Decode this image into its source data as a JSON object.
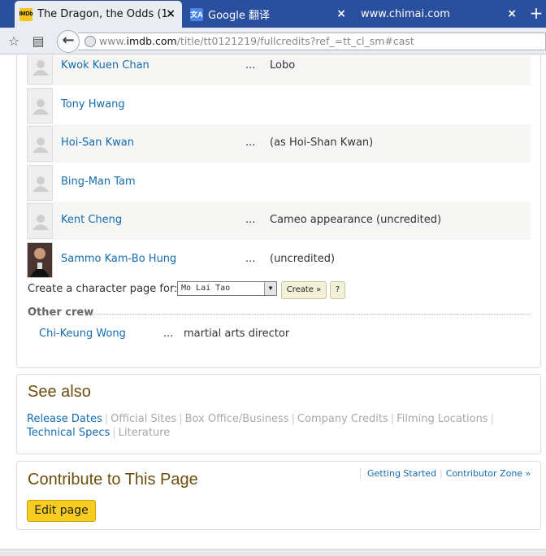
{
  "browser": {
    "tabs": [
      {
        "title": "The Dragon, the Odds (1...",
        "icon": "imdb-favicon",
        "active": true
      },
      {
        "title": "Google 翻译",
        "icon": "google-translate-favicon",
        "active": false
      },
      {
        "title": "www.chimai.com",
        "icon": "",
        "active": false
      }
    ],
    "url_prefix": "www.",
    "url_host": "imdb.com",
    "url_path": "/title/tt0121219/fullcredits?ref_=tt_cl_sm#cast",
    "new_tab": "+",
    "close": "×",
    "back": "←"
  },
  "cast": [
    {
      "name": "Kwok Kuen Chan",
      "ellipsis": "...",
      "character": "Lobo",
      "photo": "placeholder"
    },
    {
      "name": "Tony Hwang",
      "ellipsis": "",
      "character": "",
      "photo": "placeholder"
    },
    {
      "name": "Hoi-San Kwan",
      "ellipsis": "...",
      "character": "(as Hoi-Shan Kwan)",
      "photo": "placeholder"
    },
    {
      "name": "Bing-Man Tam",
      "ellipsis": "",
      "character": "",
      "photo": "placeholder"
    },
    {
      "name": "Kent Cheng",
      "ellipsis": "...",
      "character": "Cameo appearance (uncredited)",
      "photo": "placeholder"
    },
    {
      "name": "Sammo Kam-Bo Hung",
      "ellipsis": "...",
      "character": "(uncredited)",
      "photo": "headshot"
    }
  ],
  "create_character": {
    "label": "Create a character page for:",
    "selected": "Mo Lai Tao",
    "create_label": "Create »",
    "help_label": "?"
  },
  "other_crew": {
    "title": "Other crew",
    "entries": [
      {
        "name": "Chi-Keung Wong",
        "ellipsis": "...",
        "role": "martial arts director"
      }
    ]
  },
  "see_also": {
    "title": "See also",
    "links": [
      {
        "label": "Release Dates",
        "enabled": true
      },
      {
        "label": "Official Sites",
        "enabled": false
      },
      {
        "label": "Box Office/Business",
        "enabled": false
      },
      {
        "label": "Company Credits",
        "enabled": false
      },
      {
        "label": "Filming Locations",
        "enabled": false
      },
      {
        "label": "Technical Specs",
        "enabled": true
      },
      {
        "label": "Literature",
        "enabled": false
      }
    ],
    "separator": "|"
  },
  "contribute": {
    "title": "Contribute to This Page",
    "getting_started": "Getting Started",
    "contributor_zone": "Contributor Zone »",
    "separator": "|",
    "edit_button": "Edit page"
  },
  "colors": {
    "link": "#136cb2",
    "heading": "#6b4f0f",
    "edit_button": "#f5cc1f",
    "tabbar": "#2a4f9e"
  }
}
